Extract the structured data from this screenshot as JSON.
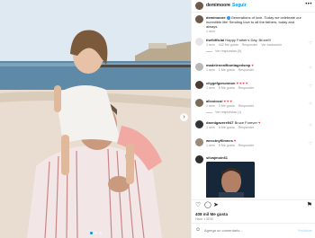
{
  "post": {
    "username": "demimoore",
    "follow_label": "Seguir",
    "separator": "•",
    "more_icon": "more-horizontal-icon"
  },
  "comments": [
    {
      "username": "demimoore",
      "verified": true,
      "text": "Generations of love. Today we celebrate our incredible life! Sending love to all the fathers, today and always.",
      "meta": [
        "1 sem"
      ],
      "replies": ""
    },
    {
      "username": "thefofficial",
      "text": "Happy Father's Day, Bruce!!!",
      "meta": [
        "1 sem",
        "442 Me gusta",
        "Responder",
        "Ver traducción"
      ],
      "replies": "Ver respuestas (5)"
    },
    {
      "username": "madelenealfbontagedsmp",
      "text": "",
      "meta": [
        "1 sem",
        "1 Me gusta",
        "Responder"
      ],
      "replies": ""
    },
    {
      "username": "cliygefgorunmon",
      "text": "",
      "meta": [
        "1 sem",
        "5 Me gusta",
        "Responder"
      ],
      "replies": ""
    },
    {
      "username": "allcoiocol",
      "text": "",
      "meta": [
        "1 sem",
        "3 Me gusta",
        "Responder"
      ],
      "replies": "Ver respuestas (1)"
    },
    {
      "username": "daredgavere947",
      "text": "Bruce Forever",
      "meta": [
        "1 sem",
        "8 Me gusta",
        "Responder"
      ],
      "replies": ""
    },
    {
      "username": "wecctnyfilmnes",
      "text": "",
      "meta": [
        "1 sem",
        "5 Me gusta",
        "Responder"
      ],
      "replies": ""
    },
    {
      "username": "silvajmoin61",
      "text": "",
      "meta": [],
      "replies": ""
    }
  ],
  "actions": {
    "like_icon": "heart-icon",
    "comment_icon": "comment-icon",
    "share_icon": "send-icon",
    "save_icon": "bookmark-icon",
    "likes": "408 mil Me gusta",
    "date": "Hace 1 SEM"
  },
  "composer": {
    "placeholder": "Agrega un comentario...",
    "publish_label": "Publicar",
    "emoji_icon": "emoji-icon"
  },
  "colors": {
    "accent": "#0095f6",
    "text": "#262626",
    "muted": "#8e8e8e",
    "border": "#efefef"
  }
}
